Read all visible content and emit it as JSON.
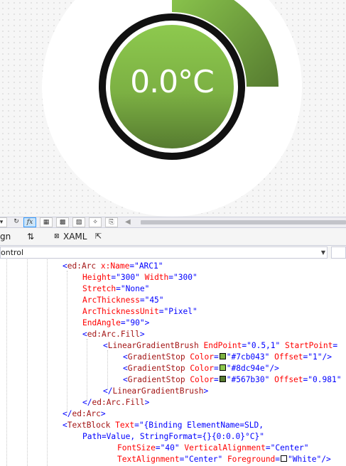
{
  "gauge": {
    "temperature_text": "0.0°C",
    "arc_colors": {
      "start": "#8dc94e",
      "end": "#567b30"
    },
    "ring_color": "#111111",
    "background_disc": "#ffffff"
  },
  "toolbar": {
    "buttons": [
      "toggle-icon",
      "refresh-icon",
      "fx-icon",
      "grid-icon",
      "grid-dots-icon",
      "pattern-icon",
      "snap-icon",
      "code-icon"
    ],
    "fx_label": "fx",
    "scroll_left_arrow": "◀"
  },
  "tabs": {
    "design_label": "gn",
    "swap_label": "⇅",
    "xaml_label": "XAML",
    "popout_icon": "popout-icon"
  },
  "nav": {
    "element_label": "ontrol"
  },
  "code": {
    "lines": [
      {
        "indent": 88,
        "parts": [
          [
            "t",
            "<"
          ],
          [
            "e",
            "ed:Arc"
          ],
          [
            "a",
            " x:Name"
          ],
          [
            "t",
            "="
          ],
          [
            "v",
            "\"ARC1\""
          ]
        ]
      },
      {
        "indent": 116,
        "parts": [
          [
            "a",
            "Height"
          ],
          [
            "t",
            "="
          ],
          [
            "v",
            "\"300\""
          ],
          [
            "a",
            " Width"
          ],
          [
            "t",
            "="
          ],
          [
            "v",
            "\"300\""
          ]
        ]
      },
      {
        "indent": 116,
        "parts": [
          [
            "a",
            "Stretch"
          ],
          [
            "t",
            "="
          ],
          [
            "v",
            "\"None\""
          ]
        ]
      },
      {
        "indent": 116,
        "parts": [
          [
            "a",
            "ArcThickness"
          ],
          [
            "t",
            "="
          ],
          [
            "v",
            "\"45\""
          ]
        ]
      },
      {
        "indent": 116,
        "parts": [
          [
            "a",
            "ArcThicknessUnit"
          ],
          [
            "t",
            "="
          ],
          [
            "v",
            "\"Pixel\""
          ]
        ]
      },
      {
        "indent": 116,
        "parts": [
          [
            "a",
            "EndAngle"
          ],
          [
            "t",
            "="
          ],
          [
            "v",
            "\"90\""
          ],
          [
            "t",
            ">"
          ]
        ]
      },
      {
        "indent": 116,
        "parts": [
          [
            "t",
            "<"
          ],
          [
            "e",
            "ed:Arc.Fill"
          ],
          [
            "t",
            ">"
          ]
        ]
      },
      {
        "indent": 145,
        "parts": [
          [
            "t",
            "<"
          ],
          [
            "e",
            "LinearGradientBrush"
          ],
          [
            "a",
            " EndPoint"
          ],
          [
            "t",
            "="
          ],
          [
            "v",
            "\"0.5,1\""
          ],
          [
            "a",
            " StartPoint"
          ],
          [
            "t",
            "="
          ]
        ]
      },
      {
        "indent": 173,
        "parts": [
          [
            "t",
            "<"
          ],
          [
            "e",
            "GradientStop"
          ],
          [
            "a",
            " Color"
          ],
          [
            "t",
            "="
          ],
          [
            "sw",
            "#7cb043"
          ],
          [
            "v",
            "\"#7cb043\""
          ],
          [
            "a",
            " Offset"
          ],
          [
            "t",
            "="
          ],
          [
            "v",
            "\"1\""
          ],
          [
            "t",
            "/>"
          ]
        ]
      },
      {
        "indent": 173,
        "parts": [
          [
            "t",
            "<"
          ],
          [
            "e",
            "GradientStop"
          ],
          [
            "a",
            " Color"
          ],
          [
            "t",
            "="
          ],
          [
            "sw",
            "#8dc94e"
          ],
          [
            "v",
            "\"#8dc94e\""
          ],
          [
            "t",
            "/>"
          ]
        ]
      },
      {
        "indent": 173,
        "parts": [
          [
            "t",
            "<"
          ],
          [
            "e",
            "GradientStop"
          ],
          [
            "a",
            " Color"
          ],
          [
            "t",
            "="
          ],
          [
            "sw",
            "#567b30"
          ],
          [
            "v",
            "\"#567b30\""
          ],
          [
            "a",
            " Offset"
          ],
          [
            "t",
            "="
          ],
          [
            "v",
            "\"0.981\""
          ]
        ]
      },
      {
        "indent": 145,
        "parts": [
          [
            "t",
            "</"
          ],
          [
            "e",
            "LinearGradientBrush"
          ],
          [
            "t",
            ">"
          ]
        ]
      },
      {
        "indent": 116,
        "parts": [
          [
            "t",
            "</"
          ],
          [
            "e",
            "ed:Arc.Fill"
          ],
          [
            "t",
            ">"
          ]
        ]
      },
      {
        "indent": 88,
        "parts": [
          [
            "t",
            "</"
          ],
          [
            "e",
            "ed:Arc"
          ],
          [
            "t",
            ">"
          ]
        ]
      },
      {
        "indent": 88,
        "parts": [
          [
            "t",
            "<"
          ],
          [
            "e",
            "TextBlock"
          ],
          [
            "a",
            " Text"
          ],
          [
            "t",
            "="
          ],
          [
            "v",
            "\"{Binding ElementName=SLD,"
          ]
        ]
      },
      {
        "indent": 116,
        "parts": [
          [
            "v",
            "Path=Value, StringFormat={}{0:0.0}°C}\""
          ]
        ]
      },
      {
        "indent": 165,
        "parts": [
          [
            "a",
            "FontSize"
          ],
          [
            "t",
            "="
          ],
          [
            "v",
            "\"40\""
          ],
          [
            "a",
            " VerticalAlignment"
          ],
          [
            "t",
            "="
          ],
          [
            "v",
            "\"Center\""
          ]
        ]
      },
      {
        "indent": 165,
        "parts": [
          [
            "a",
            "TextAlignment"
          ],
          [
            "t",
            "="
          ],
          [
            "v",
            "\"Center\""
          ],
          [
            "a",
            " Foreground"
          ],
          [
            "t",
            "="
          ],
          [
            "sw",
            "#ffffff"
          ],
          [
            "v",
            "\"White\""
          ],
          [
            "t",
            "/>"
          ]
        ]
      }
    ]
  }
}
